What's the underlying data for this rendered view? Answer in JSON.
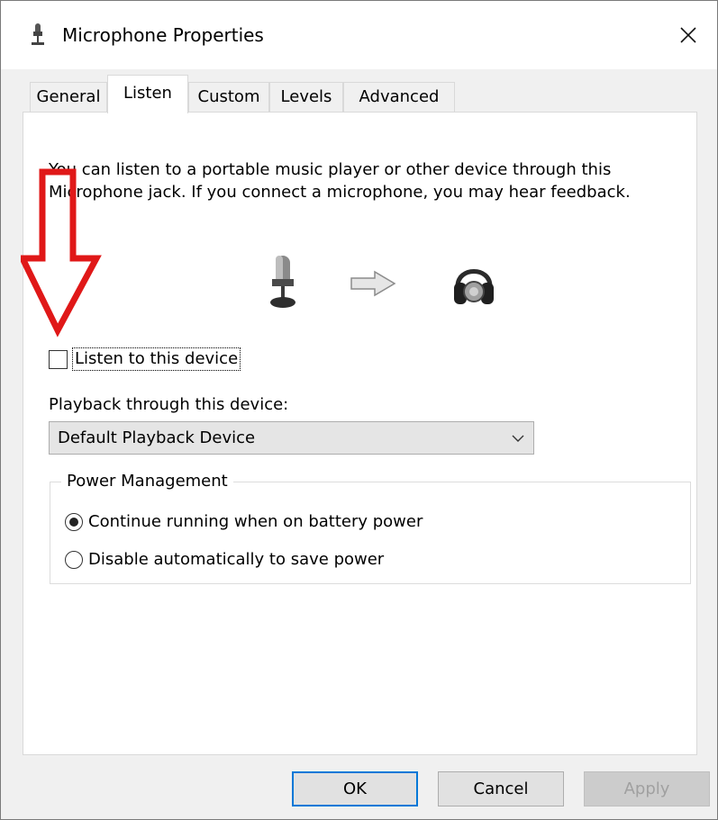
{
  "window": {
    "title": "Microphone Properties"
  },
  "tabs": [
    {
      "label": "General"
    },
    {
      "label": "Listen"
    },
    {
      "label": "Custom"
    },
    {
      "label": "Levels"
    },
    {
      "label": "Advanced"
    }
  ],
  "active_tab": "Listen",
  "listen": {
    "description": "You can listen to a portable music player or other device through this Microphone jack.  If you connect a microphone, you may hear feedback.",
    "listen_checkbox_label": "Listen to this device",
    "listen_checked": false,
    "playback_label": "Playback through this device:",
    "playback_selected": "Default Playback Device"
  },
  "power": {
    "group_title": "Power Management",
    "options": [
      {
        "label": "Continue running when on battery power",
        "checked": true
      },
      {
        "label": "Disable automatically to save power",
        "checked": false
      }
    ]
  },
  "buttons": {
    "ok": "OK",
    "cancel": "Cancel",
    "apply": "Apply"
  },
  "colors": {
    "annotation_arrow": "#e01818",
    "default_button_border": "#0078d7"
  },
  "icons": {
    "title": "microphone-icon",
    "close": "close-icon",
    "device_source": "microphone-icon",
    "flow": "right-arrow-icon",
    "device_target": "headphones-icon",
    "dropdown": "chevron-down-icon",
    "annotation": "red-down-arrow-icon"
  }
}
